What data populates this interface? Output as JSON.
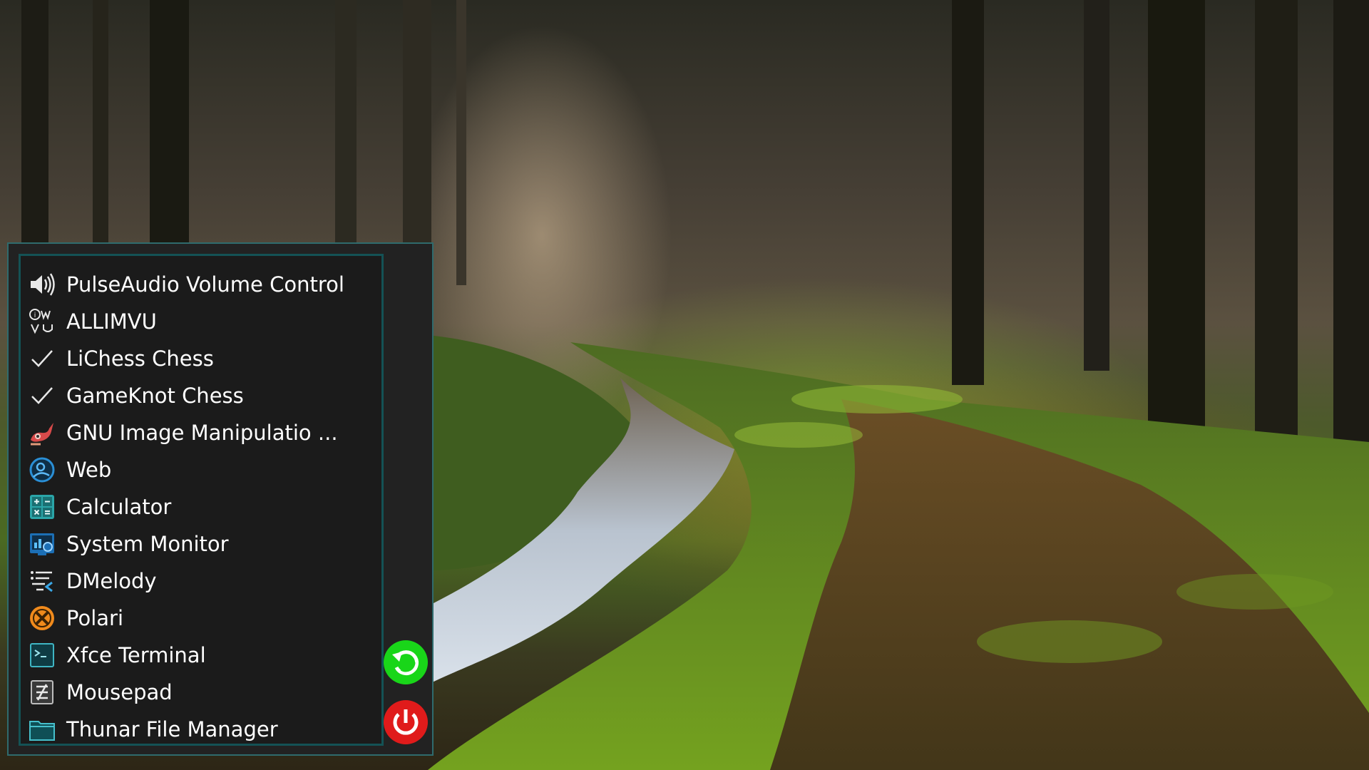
{
  "desktop": {
    "wallpaper_icon": "forest-path-wallpaper"
  },
  "app_menu": {
    "items": [
      {
        "label": "PulseAudio Volume Control",
        "icon": "speaker-volume-icon"
      },
      {
        "label": "ALLIMVU",
        "icon": "imvu-logo-icon"
      },
      {
        "label": "LiChess Chess",
        "icon": "checkmark-icon"
      },
      {
        "label": "GameKnot Chess",
        "icon": "checkmark-icon"
      },
      {
        "label": "GNU Image Manipulatio ...",
        "icon": "gimp-icon"
      },
      {
        "label": "Web",
        "icon": "web-browser-icon"
      },
      {
        "label": "Calculator",
        "icon": "calculator-icon"
      },
      {
        "label": "System Monitor",
        "icon": "system-monitor-icon"
      },
      {
        "label": "DMelody",
        "icon": "music-list-icon"
      },
      {
        "label": "Polari",
        "icon": "polari-chat-icon"
      },
      {
        "label": "Xfce Terminal",
        "icon": "terminal-icon"
      },
      {
        "label": "Mousepad",
        "icon": "text-editor-icon"
      },
      {
        "label": "Thunar File Manager",
        "icon": "folder-icon"
      }
    ],
    "restart_icon": "restart-icon",
    "power_icon": "power-icon"
  },
  "colors": {
    "panel_bg": "#222222",
    "list_bg": "#1b1b1b",
    "panel_border": "#145255",
    "restart_green": "#19d619",
    "power_red": "#e01b1b",
    "text": "#ffffff"
  }
}
